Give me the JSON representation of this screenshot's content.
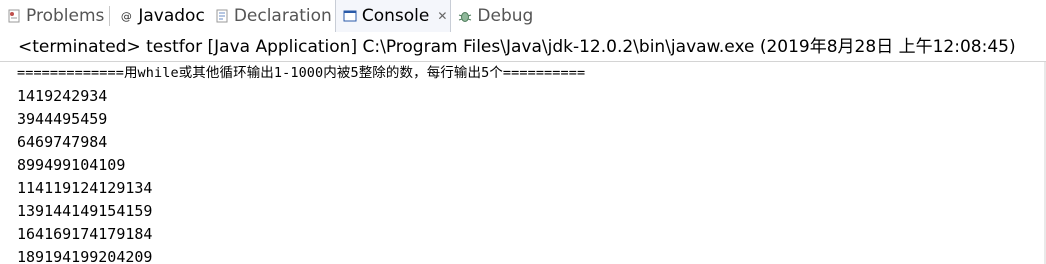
{
  "tabs": [
    {
      "label": "Problems",
      "icon": "problems-icon",
      "active": false
    },
    {
      "label": "Javadoc",
      "icon": "javadoc-icon",
      "active": false
    },
    {
      "label": "Declaration",
      "icon": "declaration-icon",
      "active": false
    },
    {
      "label": "Console",
      "icon": "console-icon",
      "active": true,
      "close": "✕"
    },
    {
      "label": "Debug",
      "icon": "debug-icon",
      "active": false
    }
  ],
  "status": "<terminated> testfor [Java Application] C:\\Program Files\\Java\\jdk-12.0.2\\bin\\javaw.exe (2019年8月28日 上午12:08:45)",
  "console": {
    "lines": [
      "=============用while或其他循环输出1-1000内被5整除的数，每行输出5个==========",
      "1419242934",
      "3944495459",
      "6469747984",
      "899499104109",
      "114119124129134",
      "139144149154159",
      "164169174179184",
      "189194199204209"
    ]
  },
  "colors": {
    "problems_icon": "#b85a5a",
    "console_icon": "#2a5aa8",
    "debug_icon": "#3a8a5a"
  }
}
